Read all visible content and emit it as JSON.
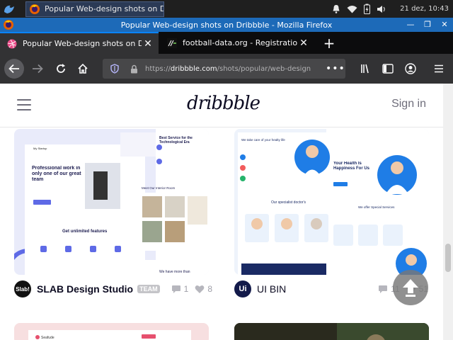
{
  "taskbar": {
    "task_label": "Popular Web-design shots on Dribbb",
    "clock": "21 dez, 10:43"
  },
  "window": {
    "title": "Popular Web-design shots on Dribbble - Mozilla Firefox"
  },
  "tabs": [
    {
      "label": "Popular Web-design shots on Dribbble",
      "active": true
    },
    {
      "label": "football-data.org - Registration",
      "active": false
    }
  ],
  "urlbar": {
    "url_prefix": "https://",
    "url_domain": "dribbble.com",
    "url_path": "/shots/popular/web-design"
  },
  "site": {
    "logo": "dribbble",
    "signin": "Sign in"
  },
  "shots": [
    {
      "avatar": "Slab!",
      "author": "SLAB Design Studio",
      "badge": "TEAM",
      "comments": "1",
      "likes": "8",
      "preview": {
        "nav_brand": "My Startup",
        "headline": "Professional work in only one of our great team",
        "service_title": "Best Service for the Technological Era",
        "interior": "Meet Our Interior Room",
        "features": "Get unlimited features",
        "more": "We have more than"
      }
    },
    {
      "avatar": "Ui",
      "author": "UI BIN",
      "comments": "11",
      "likes": "51",
      "preview": {
        "care": "We take care of your healty life",
        "health": "Your Health Is Happiness For Us",
        "doctors": "Our specialist doctor's",
        "services": "We offer Special Services"
      }
    },
    {
      "preview": {
        "brand": "Seafude"
      }
    },
    {
      "preview": {}
    }
  ],
  "colors": {
    "accent": "#0a84ff",
    "shot1_accent": "#5e6ae6",
    "shot2_accent": "#1f7de6"
  }
}
